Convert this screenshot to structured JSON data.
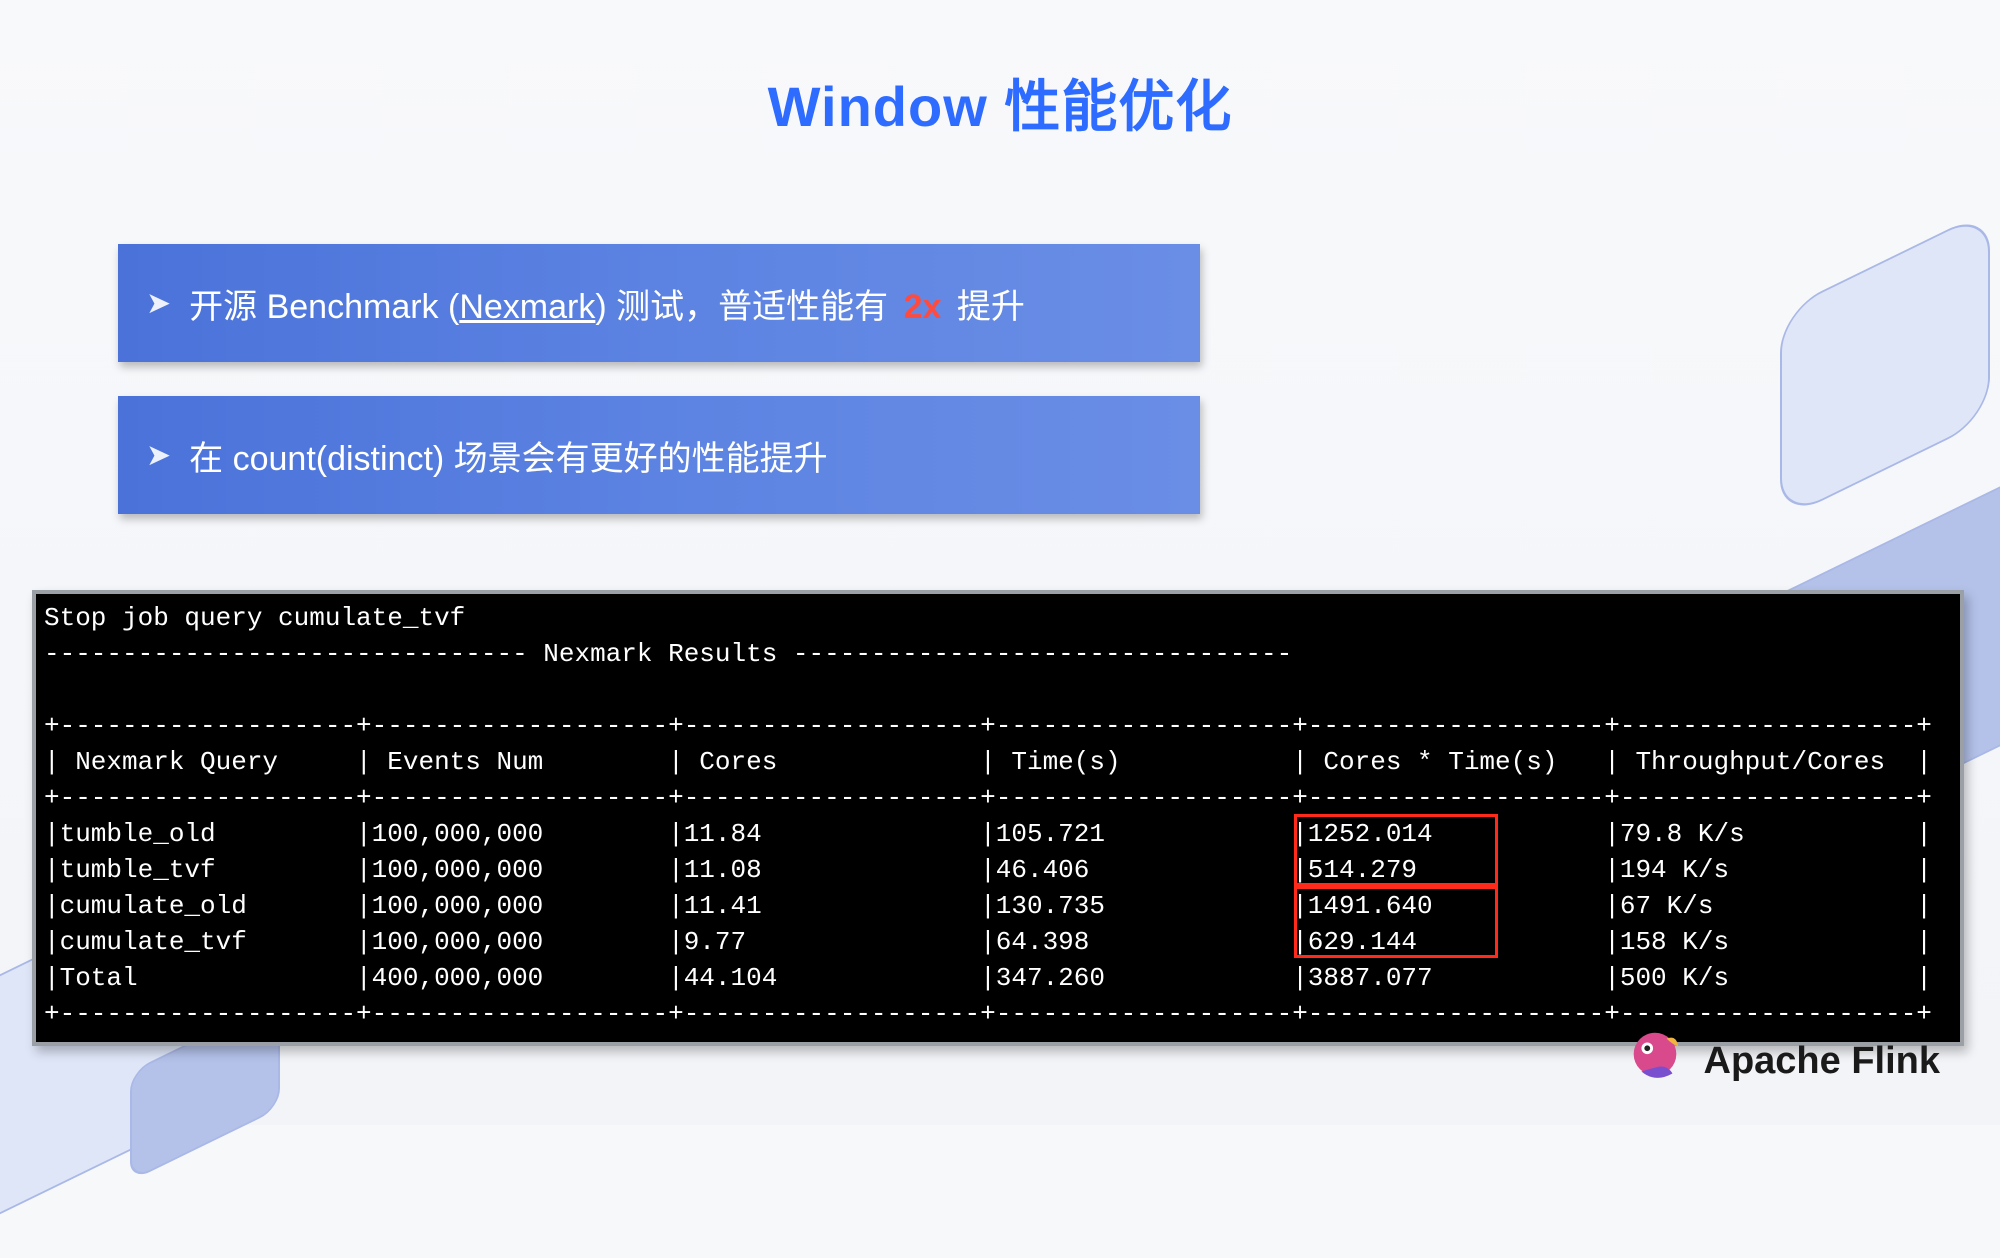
{
  "title": "Window 性能优化",
  "bullets": {
    "b1_pre": "开源 Benchmark (",
    "b1_nexmark": "Nexmark",
    "b1_mid": ") 测试，普适性能有 ",
    "b1_2x": "2x",
    "b1_post": " 提升",
    "b2": "在 count(distinct) 场景会有更好的性能提升"
  },
  "terminal": {
    "stop_line": "Stop job query cumulate_tvf",
    "banner": "------------------------------- Nexmark Results --------------------------------",
    "sep": "+-------------------+-------------------+-------------------+-------------------+-------------------+-------------------+",
    "header": "| Nexmark Query     | Events Num        | Cores             | Time(s)           | Cores * Time(s)   | Throughput/Cores  |",
    "rows": [
      "|tumble_old         |100,000,000        |11.84              |105.721            |1252.014           |79.8 K/s           |",
      "|tumble_tvf         |100,000,000        |11.08              |46.406             |514.279            |194 K/s            |",
      "|cumulate_old       |100,000,000        |11.41              |130.735            |1491.640           |67 K/s             |",
      "|cumulate_tvf       |100,000,000        |9.77               |64.398             |629.144            |158 K/s            |",
      "|Total              |400,000,000        |44.104             |347.260            |3887.077           |500 K/s            |"
    ]
  },
  "chart_data": {
    "type": "table",
    "title": "Nexmark Results",
    "columns": [
      "Nexmark Query",
      "Events Num",
      "Cores",
      "Time(s)",
      "Cores * Time(s)",
      "Throughput/Cores"
    ],
    "rows": [
      {
        "query": "tumble_old",
        "events": 100000000,
        "cores": 11.84,
        "time_s": 105.721,
        "cores_time": 1252.014,
        "throughput_per_core": "79.8 K/s"
      },
      {
        "query": "tumble_tvf",
        "events": 100000000,
        "cores": 11.08,
        "time_s": 46.406,
        "cores_time": 514.279,
        "throughput_per_core": "194 K/s"
      },
      {
        "query": "cumulate_old",
        "events": 100000000,
        "cores": 11.41,
        "time_s": 130.735,
        "cores_time": 1491.64,
        "throughput_per_core": "67 K/s"
      },
      {
        "query": "cumulate_tvf",
        "events": 100000000,
        "cores": 9.77,
        "time_s": 64.398,
        "cores_time": 629.144,
        "throughput_per_core": "158 K/s"
      },
      {
        "query": "Total",
        "events": 400000000,
        "cores": 44.104,
        "time_s": 347.26,
        "cores_time": 3887.077,
        "throughput_per_core": "500 K/s"
      }
    ],
    "highlight_column": "Cores * Time(s)",
    "highlight_groups": [
      [
        "tumble_old",
        "tumble_tvf"
      ],
      [
        "cumulate_old",
        "cumulate_tvf"
      ]
    ]
  },
  "footer": {
    "brand": "Apache Flink"
  }
}
